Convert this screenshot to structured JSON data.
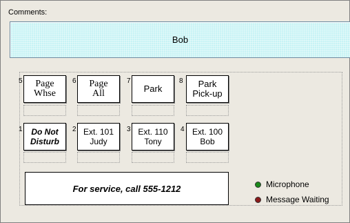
{
  "comments": {
    "label": "Comments:",
    "value": "Bob"
  },
  "keys_top": [
    {
      "num": "5",
      "label": "Page\nWhse"
    },
    {
      "num": "6",
      "label": "Page\nAll"
    },
    {
      "num": "7",
      "label": "Park"
    },
    {
      "num": "8",
      "label": "Park\nPick-up"
    }
  ],
  "keys_bottom": [
    {
      "num": "1",
      "label": "Do Not\nDisturb"
    },
    {
      "num": "2",
      "label": "Ext. 101\nJudy"
    },
    {
      "num": "3",
      "label": "Ext. 110\nTony"
    },
    {
      "num": "4",
      "label": "Ext. 100\nBob"
    }
  ],
  "service": {
    "text": "For service, call 555-1212"
  },
  "legend": {
    "microphone": {
      "label": "Microphone",
      "color": "#1a8a1a"
    },
    "message_waiting": {
      "label": "Message Waiting",
      "color": "#8b1a1a"
    }
  }
}
